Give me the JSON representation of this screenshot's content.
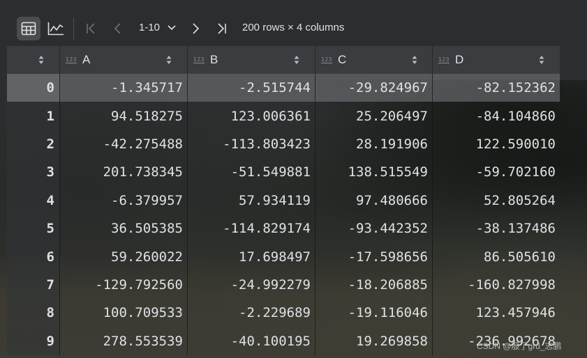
{
  "toolbar": {
    "table_view_icon": "table-grid-icon",
    "chart_view_icon": "line-chart-icon",
    "page_range": "1-10",
    "rows_cols": "200 rows × 4 columns"
  },
  "table": {
    "columns": [
      {
        "name": "A",
        "type_badge": "123"
      },
      {
        "name": "B",
        "type_badge": "123"
      },
      {
        "name": "C",
        "type_badge": "123"
      },
      {
        "name": "D",
        "type_badge": "123"
      }
    ],
    "rows": [
      {
        "index": "0",
        "A": "-1.345717",
        "B": "-2.515744",
        "C": "-29.824967",
        "D": "-82.152362"
      },
      {
        "index": "1",
        "A": "94.518275",
        "B": "123.006361",
        "C": "25.206497",
        "D": "-84.104860"
      },
      {
        "index": "2",
        "A": "-42.275488",
        "B": "-113.803423",
        "C": "28.191906",
        "D": "122.590010"
      },
      {
        "index": "3",
        "A": "201.738345",
        "B": "-51.549881",
        "C": "138.515549",
        "D": "-59.702160"
      },
      {
        "index": "4",
        "A": "-6.379957",
        "B": "57.934119",
        "C": "97.480666",
        "D": "52.805264"
      },
      {
        "index": "5",
        "A": "36.505385",
        "B": "-114.829174",
        "C": "-93.442352",
        "D": "-38.137486"
      },
      {
        "index": "6",
        "A": "59.260022",
        "B": "17.698497",
        "C": "-17.598656",
        "D": "86.505610"
      },
      {
        "index": "7",
        "A": "-129.792560",
        "B": "-24.992279",
        "C": "-18.206885",
        "D": "-160.827998"
      },
      {
        "index": "8",
        "A": "100.709533",
        "B": "-2.229689",
        "C": "-19.116046",
        "D": "123.457946"
      },
      {
        "index": "9",
        "A": "278.553539",
        "B": "-40.100195",
        "C": "19.269858",
        "D": "-236.992678"
      }
    ],
    "selected_row": "0"
  },
  "watermark": "CSDN @殷了grd_志鹏"
}
